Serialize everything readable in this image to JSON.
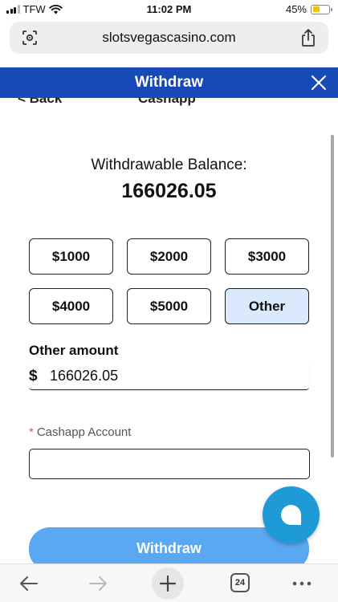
{
  "status_bar": {
    "carrier": "TFW",
    "time": "11:02 PM",
    "battery_percent": "45%",
    "battery_level": 0.45,
    "battery_color": "#f2c200"
  },
  "url_bar": {
    "url": "slotsvegascasino.com",
    "left_icon": "page-settings-icon",
    "right_icon": "share-icon"
  },
  "modal": {
    "title": "Withdraw",
    "close_icon": "close-icon",
    "header_color": "#1849b8",
    "peek_back": "< Back",
    "peek_title": "Cashapp"
  },
  "balance": {
    "label": "Withdrawable Balance:",
    "value": "166026.05"
  },
  "amounts": {
    "a1000": "$1000",
    "a2000": "$2000",
    "a3000": "$3000",
    "a4000": "$4000",
    "a5000": "$5000",
    "other": "Other",
    "selected": "Other"
  },
  "other_amount": {
    "label": "Other amount",
    "currency": "$",
    "value": "166026.05"
  },
  "cashapp": {
    "required_mark": "*",
    "label": "Cashapp Account",
    "value": ""
  },
  "withdraw_button": {
    "label": "Withdraw",
    "color": "#5aa8f2"
  },
  "chat_button": {
    "icon": "chat-bubble-icon",
    "color": "#1e9ad6"
  },
  "toolbar": {
    "back_icon": "back-arrow-icon",
    "forward_icon": "forward-arrow-icon",
    "new_tab_icon": "plus-icon",
    "tabs_count": "24",
    "more_icon": "more-dots-icon"
  }
}
